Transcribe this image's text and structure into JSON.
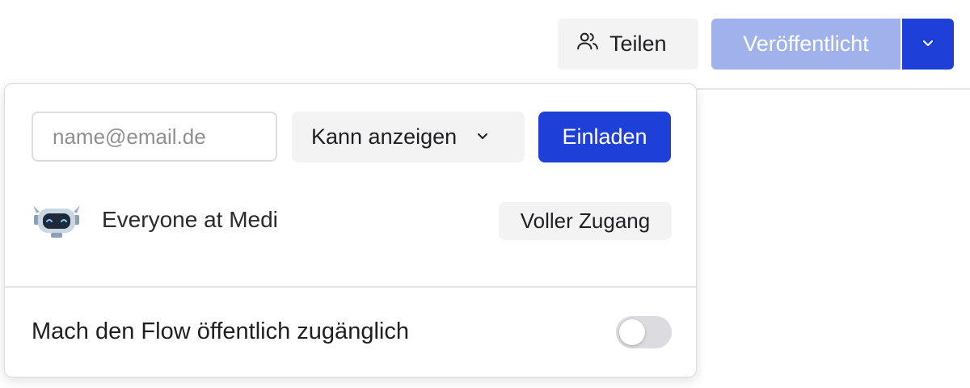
{
  "header": {
    "share_label": "Teilen",
    "share_icon": "users-icon",
    "publish_label": "Veröffentlicht",
    "publish_dropdown_icon": "chevron-down-icon"
  },
  "share_panel": {
    "email_placeholder": "name@email.de",
    "email_value": "",
    "permission_label": "Kann anzeigen",
    "invite_label": "Einladen",
    "members": [
      {
        "name": "Everyone at Medi",
        "avatar": "robot-avatar",
        "access": "Voller Zugang"
      }
    ],
    "public_toggle_label": "Mach den Flow öffentlich zugänglich",
    "public_toggle_on": false
  },
  "colors": {
    "primary": "#1e40d8",
    "primary_light": "#9fb2ec",
    "neutral_button": "#f3f3f4",
    "toggle_off": "#dcdce0"
  }
}
